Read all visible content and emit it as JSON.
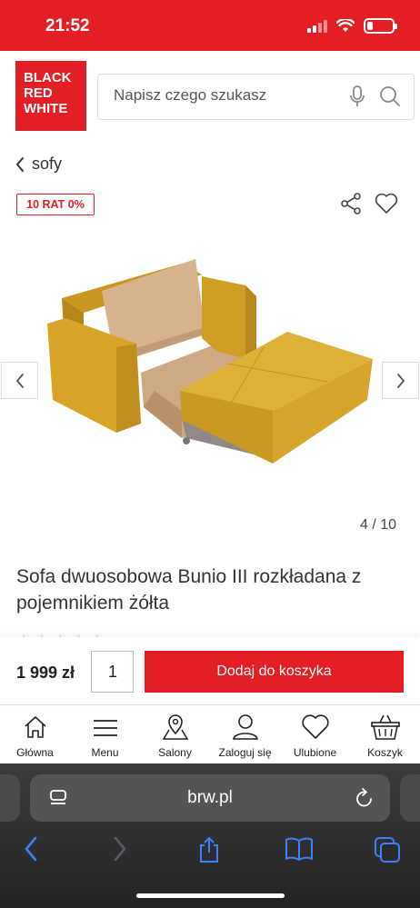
{
  "status": {
    "time": "21:52"
  },
  "logo": {
    "line1": "BLACK",
    "line2": "RED",
    "line3": "WHITE"
  },
  "search": {
    "placeholder": "Napisz czego szukasz"
  },
  "breadcrumb": {
    "label": "sofy"
  },
  "badge": {
    "label": "10 RAT 0%"
  },
  "gallery": {
    "counter": "4 / 10"
  },
  "product": {
    "title": "Sofa dwuosobowa Bunio III rozkładana z pojemnikiem żółta",
    "rating_stars": 5
  },
  "cart": {
    "price": "1 999 zł",
    "quantity": "1",
    "add_label": "Dodaj do koszyka"
  },
  "nav": {
    "items": [
      {
        "label": "Główna",
        "icon": "home-icon"
      },
      {
        "label": "Menu",
        "icon": "menu-icon"
      },
      {
        "label": "Salony",
        "icon": "map-pin-icon"
      },
      {
        "label": "Zaloguj się",
        "icon": "user-icon"
      },
      {
        "label": "Ulubione",
        "icon": "heart-icon"
      },
      {
        "label": "Koszyk",
        "icon": "basket-icon"
      }
    ]
  },
  "browser": {
    "url": "brw.pl"
  },
  "colors": {
    "brand_red": "#e31e24",
    "sofa_yellow": "#d9a62a"
  }
}
